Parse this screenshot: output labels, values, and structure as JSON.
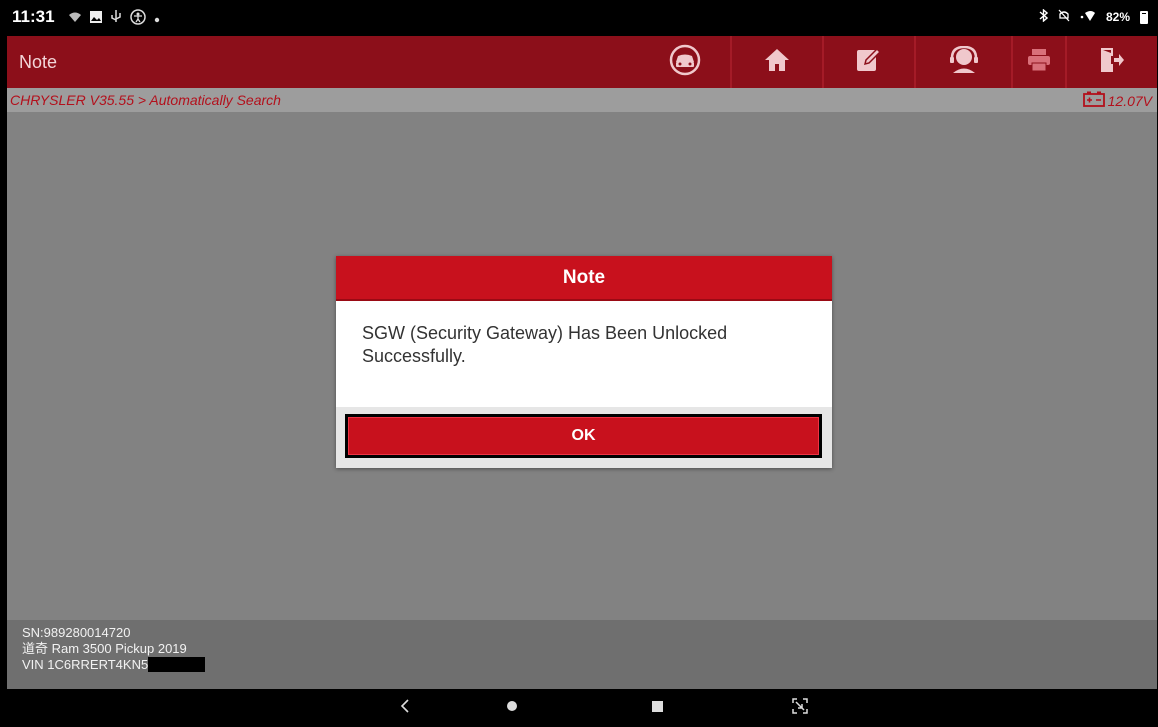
{
  "status_bar": {
    "time": "11:31",
    "left_icons": [
      "wifi-calling-icon",
      "image-icon",
      "usb-icon",
      "accessibility-icon",
      "dot-icon"
    ],
    "battery_percent": "82%",
    "right_icons": [
      "bluetooth-icon",
      "mute-icon",
      "wifi-icon",
      "battery-icon"
    ]
  },
  "titlebar": {
    "title": "Note",
    "buttons": [
      {
        "name": "diagnostic-button",
        "icon": "car-icon"
      },
      {
        "name": "home-button",
        "icon": "home-icon"
      },
      {
        "name": "edit-report-button",
        "icon": "edit-icon"
      },
      {
        "name": "remote-support-button",
        "icon": "user-support-icon"
      },
      {
        "name": "print-button",
        "icon": "printer-icon"
      },
      {
        "name": "exit-button",
        "icon": "exit-icon"
      }
    ]
  },
  "breadcrumb": {
    "path": "CHRYSLER V35.55 > Automatically Search",
    "voltage": "12.07V"
  },
  "dialog": {
    "title": "Note",
    "message": "SGW (Security Gateway) Has Been Unlocked Successfully.",
    "ok_label": "OK"
  },
  "footer": {
    "serial": "SN:989280014720",
    "vehicle": "道奇 Ram 3500 Pickup 2019",
    "vin": "VIN 1C6RRERT4KN5"
  },
  "colors": {
    "brand_red": "#8c0f1a",
    "dialog_red": "#c8111d",
    "content_gray": "#828282"
  }
}
